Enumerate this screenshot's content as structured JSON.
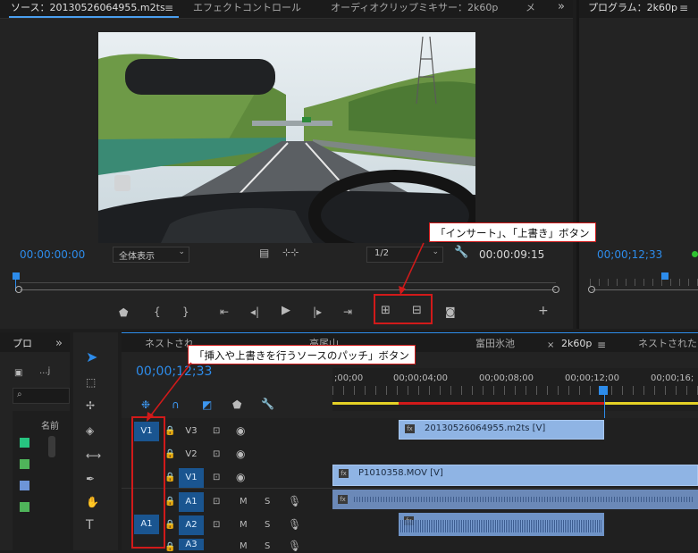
{
  "source_monitor": {
    "tabs": [
      {
        "label": "ソース：20130526064955.m2ts",
        "active": true
      },
      {
        "label": "エフェクトコントロール",
        "active": false
      },
      {
        "label": "オーディオクリップミキサー：2k60p",
        "active": false
      },
      {
        "label": "メ",
        "active": false
      }
    ],
    "timecode_in": "00:00:00:00",
    "zoom_select": "全体表示",
    "resolution_select": "1/2",
    "timecode_duration": "00:00:09:15"
  },
  "program_monitor": {
    "tab_label": "プログラム：2k60p",
    "timecode": "00;00;12;33"
  },
  "project_panel": {
    "tab_label": "プロ",
    "item_label": "...j",
    "column_header": "名前",
    "colors": [
      "#27c480",
      "#4fb45a",
      "#6d95d8",
      "#4fb45a"
    ]
  },
  "timeline": {
    "tabs": [
      {
        "label": "ネストされ",
        "active": false
      },
      {
        "label": "高尾山",
        "active": false
      },
      {
        "label": "富田氷池",
        "active": false
      },
      {
        "label": "2k60p",
        "active": true
      },
      {
        "label": "ネストされたシ",
        "active": false
      }
    ],
    "timecode": "00;00;12;33",
    "ruler": [
      ";00;00",
      "00;00;04;00",
      "00;00;08;00",
      "00;00;12;00",
      "00;00;16;"
    ],
    "source_patch_video": "V1",
    "source_patch_audio": "A1",
    "tracks": [
      {
        "name": "V3",
        "kind": "video"
      },
      {
        "name": "V2",
        "kind": "video"
      },
      {
        "name": "V1",
        "kind": "video"
      },
      {
        "name": "A1",
        "kind": "audio",
        "m": "M",
        "s": "S"
      },
      {
        "name": "A2",
        "kind": "audio",
        "m": "M",
        "s": "S"
      },
      {
        "name": "A3",
        "kind": "audio",
        "m": "M",
        "s": "S"
      }
    ],
    "clips": {
      "v3_clip": "20130526064955.m2ts [V]",
      "v1_clip": "P1010358.MOV [V]"
    }
  },
  "annotations": {
    "insert_overwrite": "「インサート」、「上書き」ボタン",
    "source_patch": "「挿入や上書きを行うソースのパッチ」ボタン"
  },
  "colors": {
    "accent_blue": "#2d8ceb",
    "annotation_red": "#d11a1a",
    "work_area_yellow": "#e5d126"
  }
}
